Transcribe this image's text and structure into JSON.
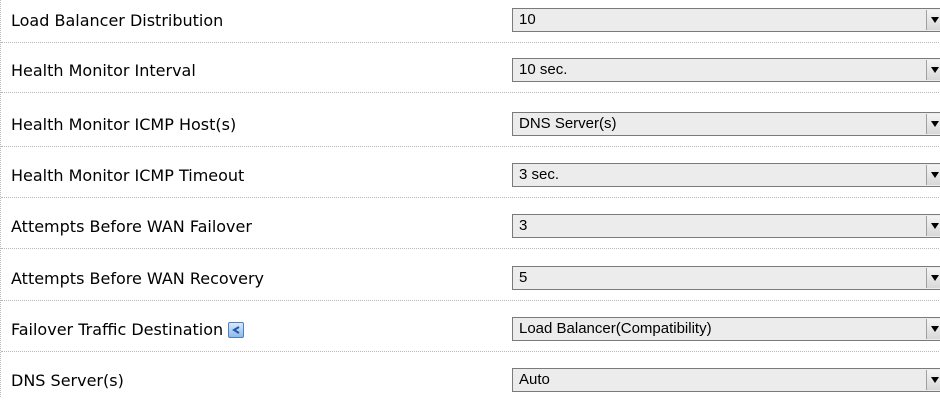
{
  "settings": {
    "rows": [
      {
        "label": "Load Balancer Distribution",
        "value": "10"
      },
      {
        "label": "Health Monitor Interval",
        "value": "10 sec."
      },
      {
        "label": "Health Monitor ICMP Host(s)",
        "value": "DNS Server(s)"
      },
      {
        "label": "Health Monitor ICMP Timeout",
        "value": "3 sec."
      },
      {
        "label": "Attempts Before WAN Failover",
        "value": "3"
      },
      {
        "label": "Attempts Before WAN Recovery",
        "value": "5"
      },
      {
        "label": "Failover Traffic Destination",
        "value": "Load Balancer(Compatibility)",
        "icon": "help-info-icon"
      },
      {
        "label": "DNS Server(s)",
        "value": "Auto"
      }
    ]
  }
}
